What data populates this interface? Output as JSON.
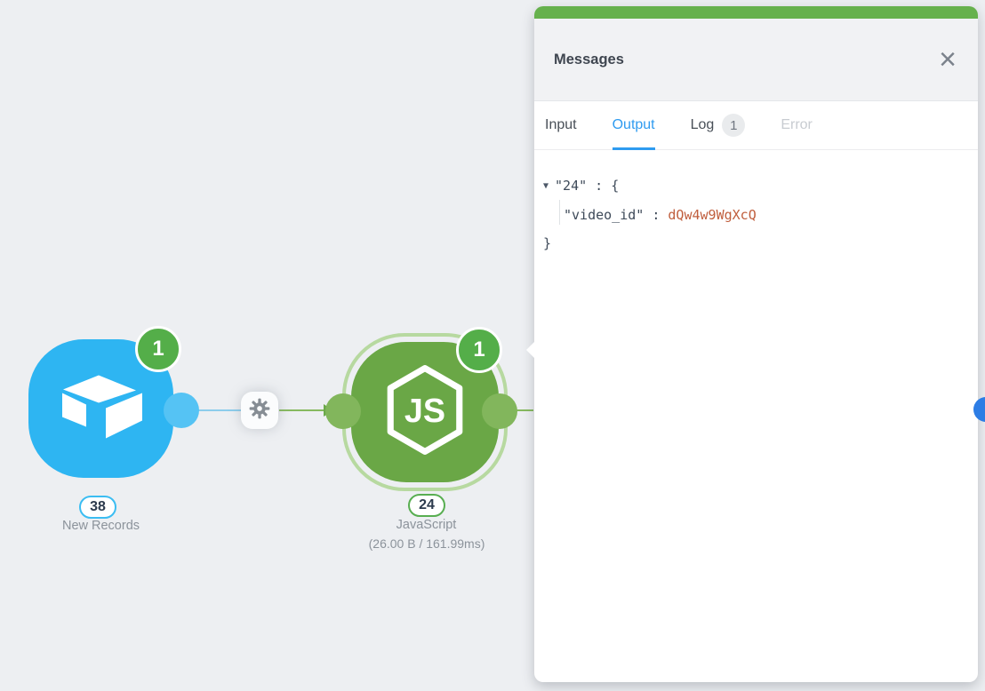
{
  "panel": {
    "title": "Messages",
    "close_icon": "×",
    "tabs": [
      {
        "label": "Input",
        "state": "normal"
      },
      {
        "label": "Output",
        "state": "active"
      },
      {
        "label": "Log",
        "state": "normal",
        "badge": "1"
      },
      {
        "label": "Error",
        "state": "disabled"
      }
    ],
    "output_json": {
      "expander": "▼",
      "root_key": "\"24\"",
      "root_open": " : {",
      "child_key": "\"video_id\"",
      "separator": " : ",
      "child_value": "dQw4w9WgXcQ",
      "close_brace": "}"
    }
  },
  "nodes": [
    {
      "label": "New Records",
      "count": "38",
      "badge": "1",
      "icon": "airtable-icon"
    },
    {
      "label": "JavaScript",
      "count": "24",
      "badge": "1",
      "stats": "(26.00 B / 161.99ms)",
      "icon": "nodejs-icon"
    }
  ],
  "colors": {
    "canvas_bg": "#edeff2",
    "node_blue": "#2eb5f2",
    "node_green": "#6aa746",
    "badge_green": "#54ae49",
    "panel_accent_green": "#66b14d",
    "tab_active_blue": "#2e9bf0",
    "json_value_orange": "#c05e3d",
    "edge_dot_blue": "#2d7de5"
  }
}
